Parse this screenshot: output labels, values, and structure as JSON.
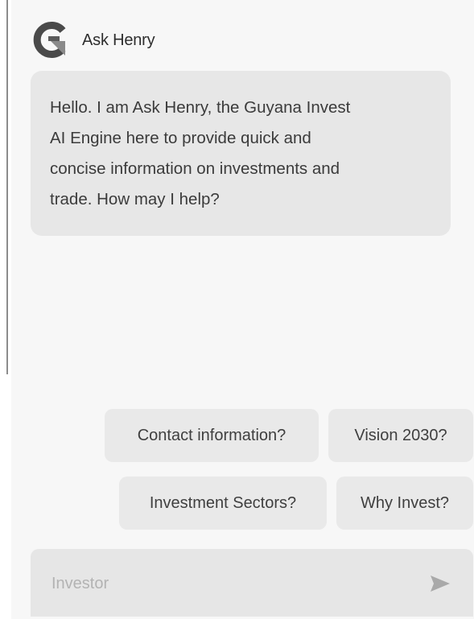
{
  "header": {
    "logo_icon": "guyana-invest-g-logo-icon",
    "bot_name": "Ask Henry"
  },
  "messages": [
    {
      "from": "bot",
      "lines": [
        "Hello. I am Ask Henry, the Guyana Invest",
        "AI Engine here to provide quick and",
        "concise information on investments and",
        "trade. How may I help?"
      ]
    }
  ],
  "suggestions": [
    "Contact information?",
    "Vision 2030?",
    "Investment Sectors?",
    "Why Invest?"
  ],
  "composer": {
    "placeholder": "Investor",
    "value": "",
    "send_icon": "send-arrow-icon"
  },
  "colors": {
    "panel_bg": "#f7f7f7",
    "bubble_bg": "#e7e7e7",
    "chip_bg": "#e9e9e9",
    "input_bg": "#e6e6e6",
    "logo_dark": "#4a4a4a",
    "logo_light": "#8a8a8a"
  }
}
